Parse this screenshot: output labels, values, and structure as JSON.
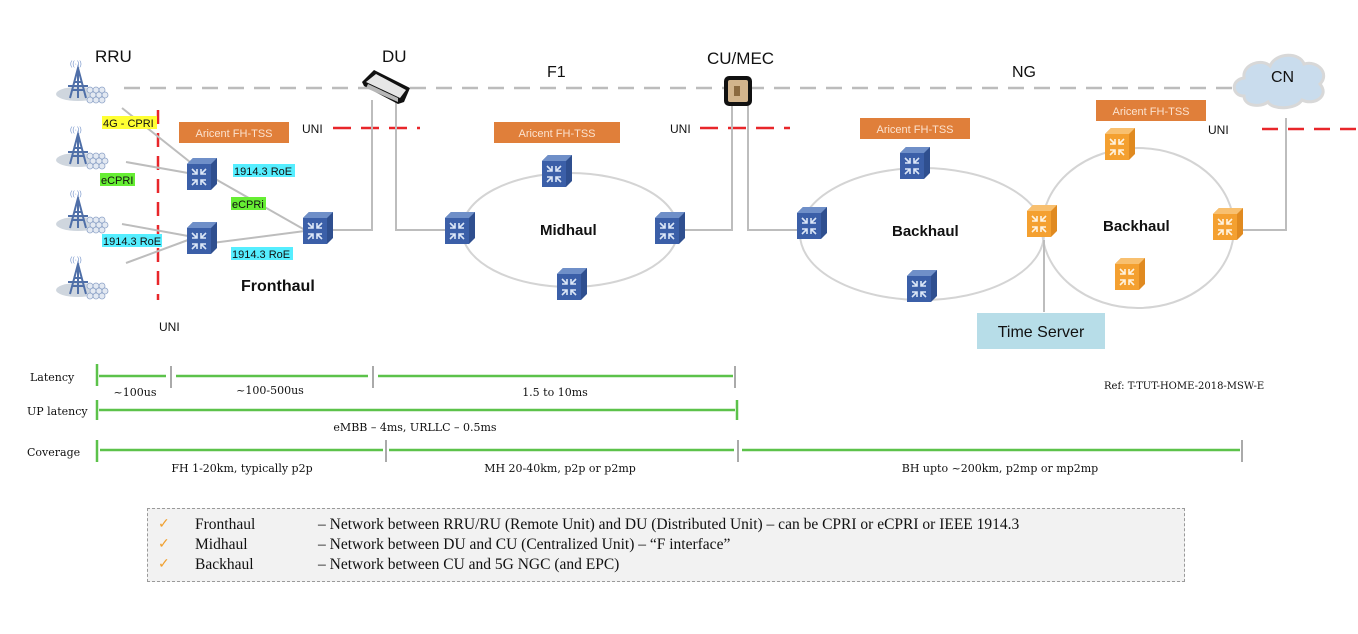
{
  "nodes": {
    "rru_label": "RRU",
    "du_label": "DU",
    "cu_label": "CU/MEC",
    "cn_label": "CN",
    "time_server_label": "Time Server"
  },
  "interfaces": {
    "f1_label": "F1",
    "ng_label": "NG",
    "uni_label": "UNI"
  },
  "link_tags": [
    {
      "text": "4G - CPRI",
      "color": "#ffff33"
    },
    {
      "text": "eCPRI",
      "color": "#66ee33"
    },
    {
      "text": "1914.3 RoE",
      "color": "#55eeff"
    },
    {
      "text": "1914.3 RoE",
      "color": "#55eeff"
    },
    {
      "text": "eCPRi",
      "color": "#66ee33"
    },
    {
      "text": "1914.3 RoE",
      "color": "#55eeff"
    }
  ],
  "tss_label": "Aricent FH-TSS",
  "segments": {
    "fronthaul": "Fronthaul",
    "midhaul": "Midhaul",
    "backhaul_1": "Backhaul",
    "backhaul_2": "Backhaul"
  },
  "metrics": {
    "latency_label": "Latency",
    "up_latency_label": "UP latency",
    "coverage_label": "Coverage",
    "latency_values": [
      "~100us",
      "~100-500us",
      "1.5 to 10ms"
    ],
    "up_latency_value": "eMBB – 4ms, URLLC – 0.5ms",
    "coverage_values": [
      "FH 1-20km, typically p2p",
      "MH 20-40km, p2p or p2mp",
      "BH  upto ~200km, p2mp or mp2mp"
    ],
    "reference": "Ref: T-TUT-HOME-2018-MSW-E"
  },
  "legend": [
    {
      "check": "✓",
      "term": "Fronthaul",
      "desc": "– Network between RRU/RU (Remote Unit) and DU (Distributed Unit) – can be CPRI or eCPRI or IEEE 1914.3"
    },
    {
      "check": "✓",
      "term": "Midhaul",
      "desc": "– Network between DU and CU (Centralized Unit) – “F interface”"
    },
    {
      "check": "✓",
      "term": "Backhaul",
      "desc": "– Network between CU and 5G NGC (and EPC)"
    }
  ],
  "colors": {
    "tss_orange": "#e07f3a",
    "switch_blue": "#3b5fa8",
    "switch_orange": "#f4a030",
    "uni_red": "#e8262a",
    "arrow_green": "#5cc24a",
    "time_server_bg": "#b7dde8"
  }
}
